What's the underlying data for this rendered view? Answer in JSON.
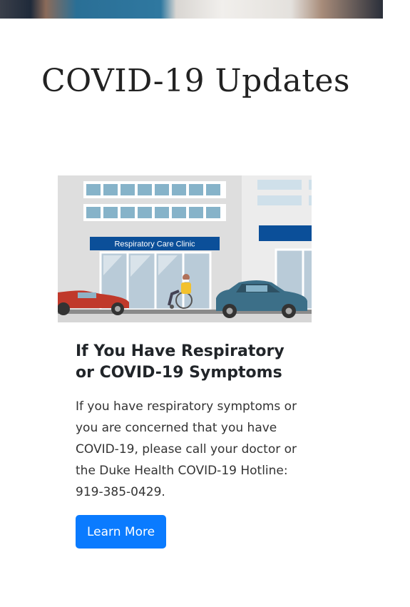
{
  "hero": {
    "alt": "people photo banner"
  },
  "page": {
    "title": "COVID-19 Updates"
  },
  "card": {
    "image_sign": "Respiratory Care Clinic",
    "title": "If You Have Respiratory or COVID-19 Symptoms",
    "text": "If you have respiratory symptoms or you are concerned that you have COVID-19, please call your doctor or the Duke Health COVID-19 Hotline: 919-385-0429.",
    "button_label": "Learn More"
  },
  "colors": {
    "button": "#0a7bff",
    "sign": "#0b4f99",
    "building": "#dcdcdc",
    "window": "#86b3c9",
    "red_car": "#c0392b",
    "blue_car": "#3c6f88"
  }
}
